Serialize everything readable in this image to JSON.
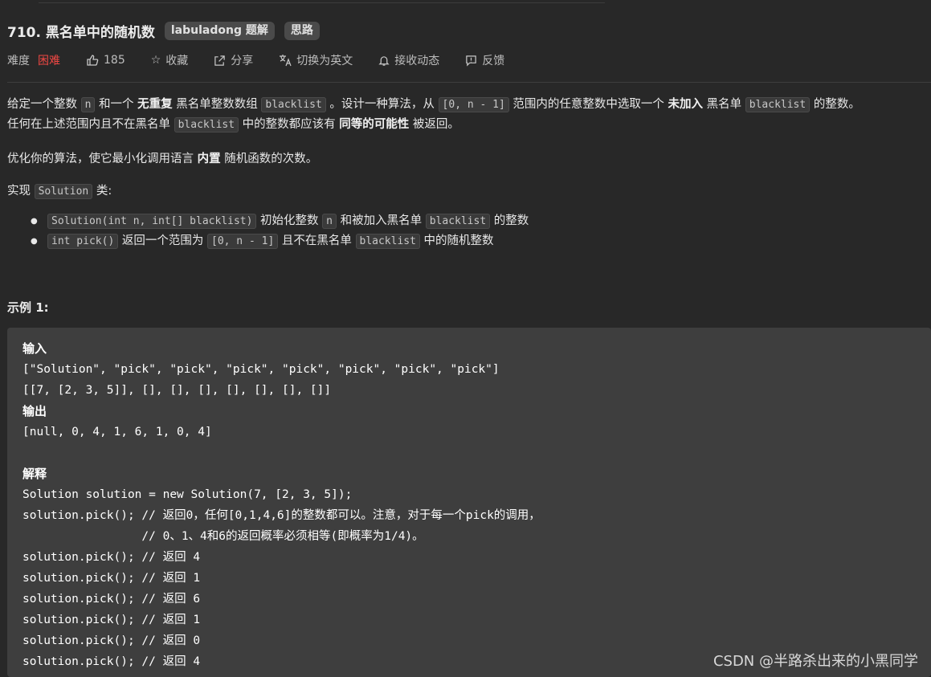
{
  "problem": {
    "title": "710. 黑名单中的随机数",
    "tags": [
      "labuladong 题解",
      "思路"
    ]
  },
  "meta": {
    "difficulty_label": "难度",
    "difficulty_value": "困难",
    "likes": "185",
    "favorite": "收藏",
    "share": "分享",
    "switch_lang": "切换为英文",
    "notify": "接收动态",
    "feedback": "反馈"
  },
  "desc": {
    "p1": {
      "a": "给定一个整数 ",
      "n": "n",
      "b": " 和一个 ",
      "b1": "无重复",
      "c": " 黑名单整数数组 ",
      "bl": "blacklist",
      "d": " 。设计一种算法，从 ",
      "range": "[0, n - 1]",
      "e": " 范围内的任意整数中选取一个 ",
      "b2": "未加入",
      "f": " 黑名单 ",
      "bl2": "blacklist",
      "g": " 的整数。"
    },
    "p1b": {
      "a": "任何在上述范围内且不在黑名单 ",
      "bl": "blacklist",
      "b": " 中的整数都应该有 ",
      "b1": "同等的可能性",
      "c": " 被返回。"
    },
    "p2": {
      "a": "优化你的算法，使它最小化调用语言 ",
      "b1": "内置",
      "b": " 随机函数的次数。"
    },
    "p3": {
      "a": "实现 ",
      "code": "Solution",
      "b": " 类:"
    },
    "bullet1": {
      "code": "Solution(int n, int[] blacklist)",
      "a": " 初始化整数 ",
      "n": "n",
      "b": " 和被加入黑名单 ",
      "bl": "blacklist",
      "c": " 的整数"
    },
    "bullet2": {
      "code": "int pick()",
      "a": " 返回一个范围为 ",
      "range": "[0, n - 1]",
      "b": " 且不在黑名单 ",
      "bl": "blacklist",
      "c": " 中的随机整数"
    }
  },
  "example": {
    "title": "示例 1:",
    "input_label": "输入",
    "input_line1": "[\"Solution\", \"pick\", \"pick\", \"pick\", \"pick\", \"pick\", \"pick\", \"pick\"]",
    "input_line2": "[[7, [2, 3, 5]], [], [], [], [], [], [], []]",
    "output_label": "输出",
    "output_line": "[null, 0, 4, 1, 6, 1, 0, 4]",
    "explain_label": "解释",
    "explain_lines": [
      "Solution solution = new Solution(7, [2, 3, 5]);",
      "solution.pick(); // 返回0，任何[0,1,4,6]的整数都可以。注意，对于每一个pick的调用，",
      "                 // 0、1、4和6的返回概率必须相等(即概率为1/4)。",
      "solution.pick(); // 返回 4",
      "solution.pick(); // 返回 1",
      "solution.pick(); // 返回 6",
      "solution.pick(); // 返回 1",
      "solution.pick(); // 返回 0",
      "solution.pick(); // 返回 4"
    ]
  },
  "watermark": "CSDN @半路杀出来的小黑同学"
}
